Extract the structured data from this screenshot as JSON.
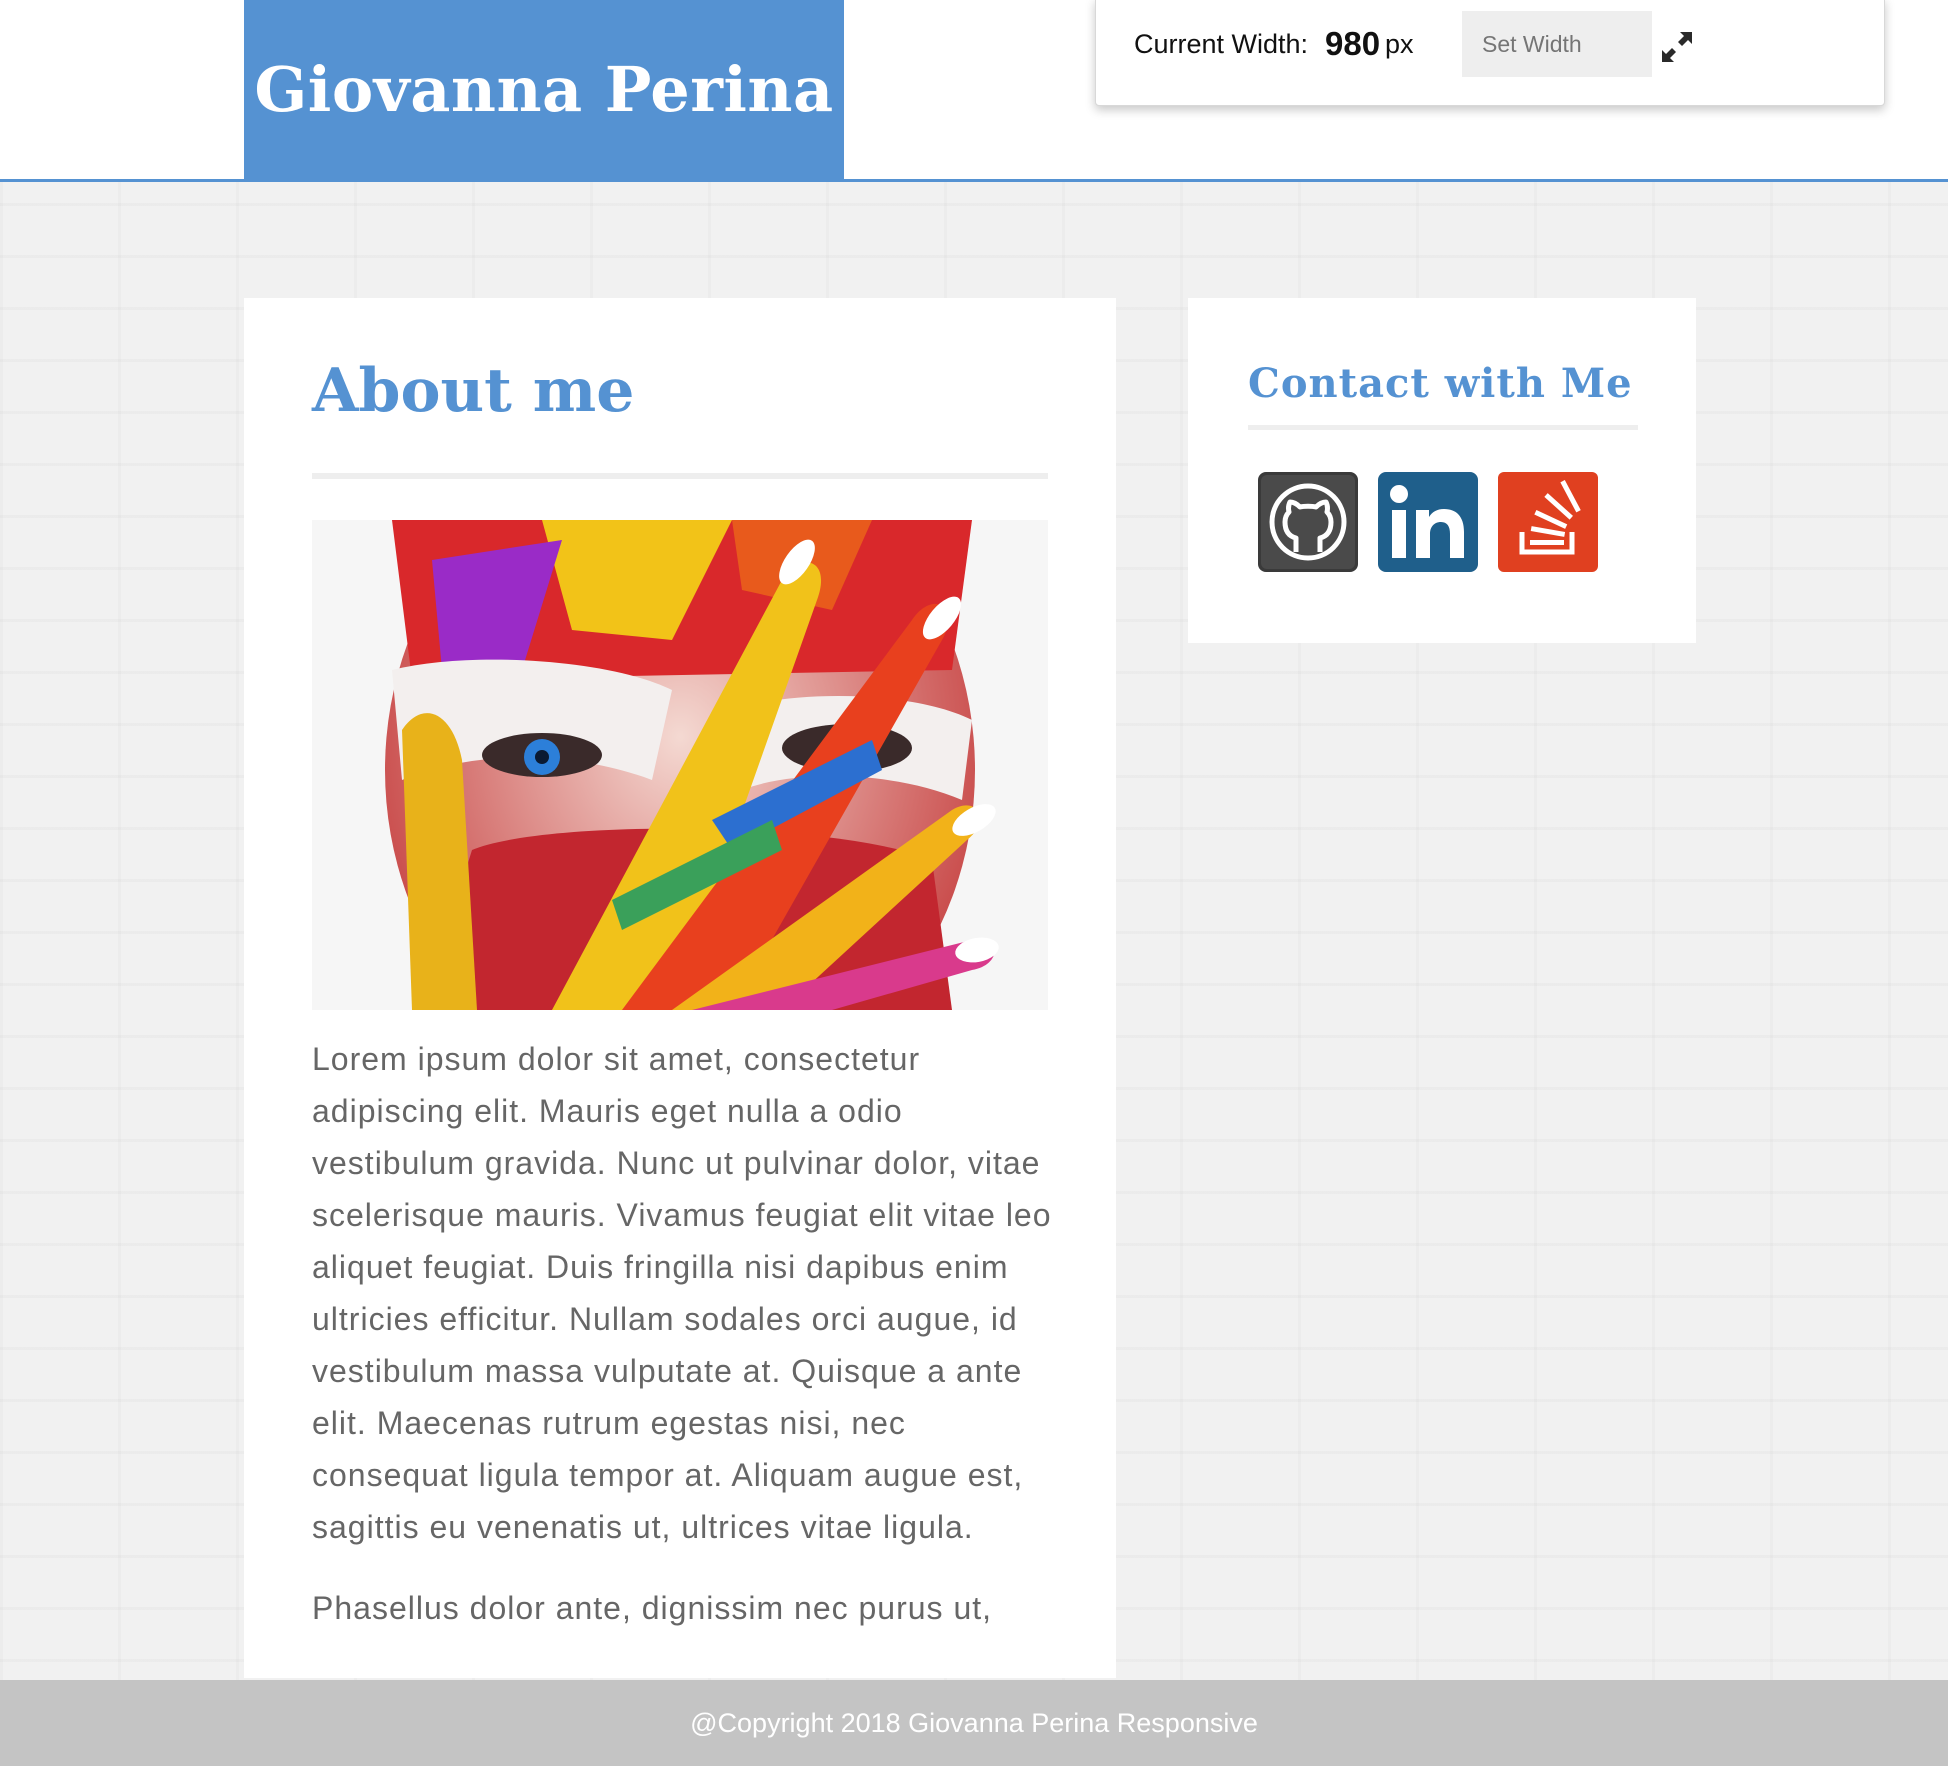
{
  "header": {
    "brand_name": "Giovanna Perina"
  },
  "width_tool": {
    "label": "Current Width:",
    "value": "980",
    "unit": "px",
    "input_placeholder": "Set Width",
    "expand_icon": "expand-arrows-icon"
  },
  "about": {
    "title": "About me",
    "image_icon": "painted-face-photo",
    "paragraphs": [
      "Lorem ipsum dolor sit amet, consectetur adipiscing elit. Mauris eget nulla a odio vestibulum gravida. Nunc ut pulvinar dolor, vitae scelerisque mauris. Vivamus feugiat elit vitae leo aliquet feugiat. Duis fringilla nisi dapibus enim ultricies efficitur. Nullam sodales orci augue, id vestibulum massa vulputate at. Quisque a ante elit. Maecenas rutrum egestas nisi, nec consequat ligula tempor at. Aliquam augue est, sagittis eu venenatis ut, ultrices vitae ligula.",
      "Phasellus dolor ante, dignissim nec purus ut,"
    ]
  },
  "contact": {
    "title": "Contact with Me",
    "links": [
      {
        "icon": "github-icon",
        "color": "#3a3a3a"
      },
      {
        "icon": "linkedin-icon",
        "color": "#1f5f8b"
      },
      {
        "icon": "stackoverflow-icon",
        "color": "#e04020"
      }
    ]
  },
  "footer": {
    "text": "@Copyright 2018 Giovanna Perina Responsive"
  },
  "colors": {
    "accent": "#5592d2",
    "footer_bg": "#c4c4c4",
    "body_text": "#666666"
  }
}
